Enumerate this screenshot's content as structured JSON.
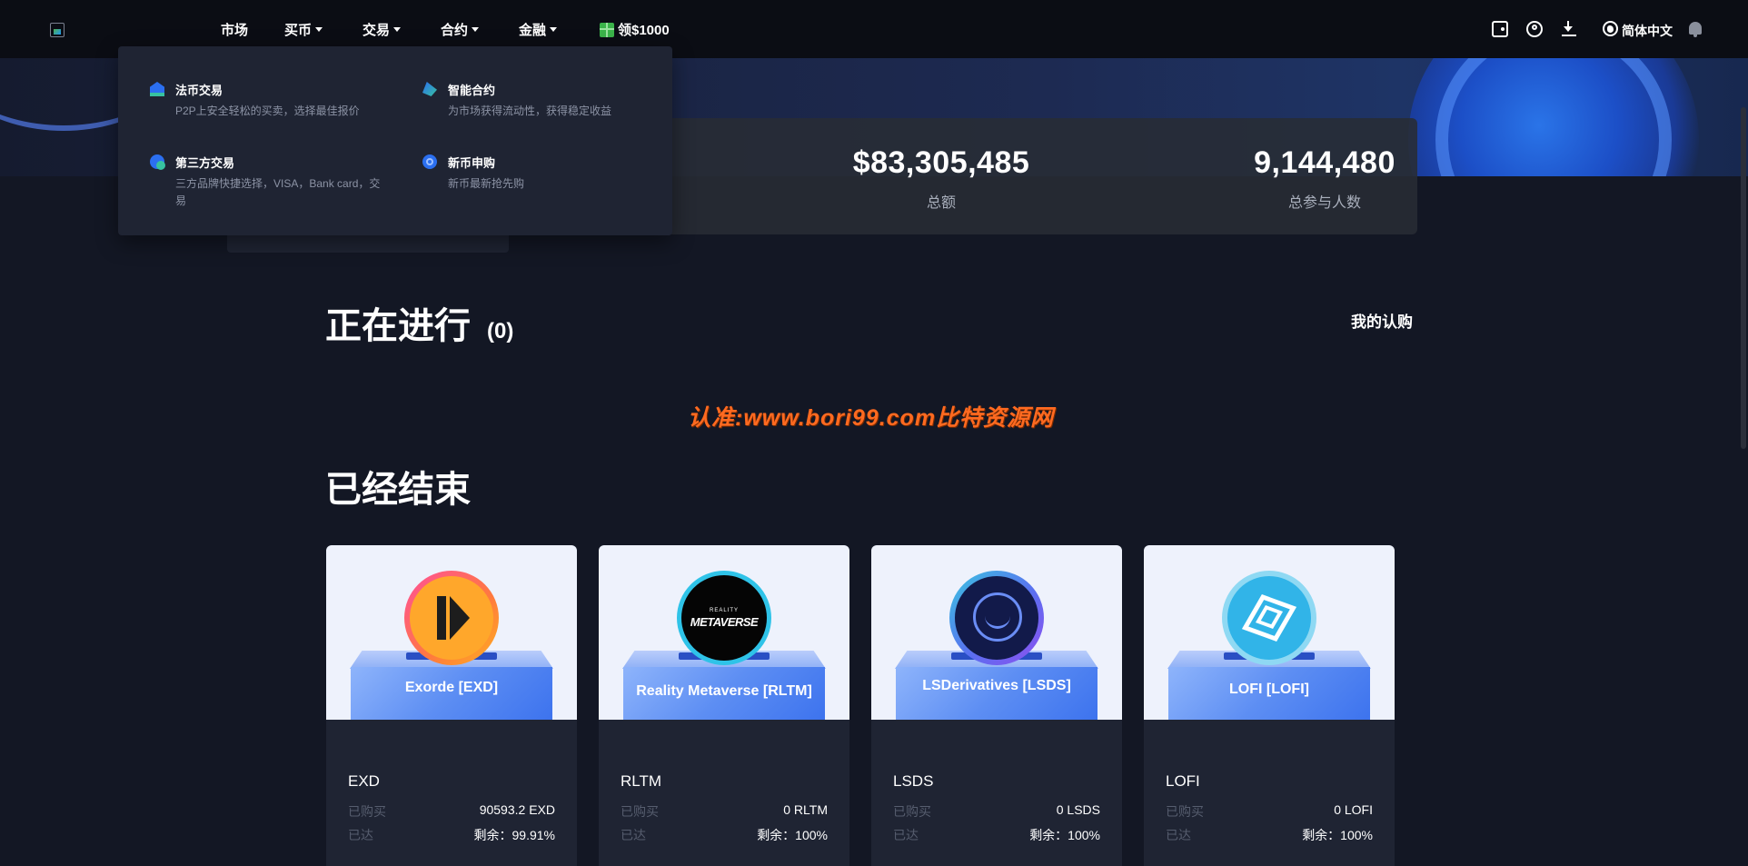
{
  "nav": {
    "items": [
      {
        "label": "市场",
        "has_caret": false
      },
      {
        "label": "买币",
        "has_caret": true
      },
      {
        "label": "交易",
        "has_caret": true
      },
      {
        "label": "合约",
        "has_caret": true
      },
      {
        "label": "金融",
        "has_caret": true
      }
    ],
    "bonus_label": "领$1000",
    "icons": [
      "wallet-icon",
      "user-icon",
      "download-icon",
      "globe-icon",
      "bell-icon"
    ],
    "language": "简体中文"
  },
  "dropdown": {
    "items": [
      {
        "icon": "fiat-icon",
        "title": "法币交易",
        "desc": "P2P上安全轻松的买卖，选择最佳报价"
      },
      {
        "icon": "smart-contract-icon",
        "title": "智能合约",
        "desc": "为市场获得流动性，获得稳定收益"
      },
      {
        "icon": "third-party-icon",
        "title": "第三方交易",
        "desc": "三方品牌快捷选择，VISA，Bank card，交易"
      },
      {
        "icon": "new-coin-icon",
        "title": "新币申购",
        "desc": "新币最新抢先购"
      }
    ]
  },
  "stats": [
    {
      "value": "$83,305,485",
      "label": "总额"
    },
    {
      "value": "9,144,480",
      "label": "总参与人数"
    }
  ],
  "ongoing": {
    "title": "正在进行",
    "count": "(0)",
    "my_subscription": "我的认购"
  },
  "watermark": "认准:www.bori99.com比特资源网",
  "ended": {
    "title": "已经结束",
    "cards": [
      {
        "box_label": "Exorde [EXD]",
        "symbol": "EXD",
        "bought_label": "已购买",
        "bought_value": "90593.2 EXD",
        "reached_label": "已达",
        "remaining": "剩余：99.91%"
      },
      {
        "box_label": "Reality Metaverse [RLTM]",
        "symbol": "RLTM",
        "bought_label": "已购买",
        "bought_value": "0 RLTM",
        "reached_label": "已达",
        "remaining": "剩余：100%",
        "coin_small": "REALITY",
        "coin_main": "METAVERSE"
      },
      {
        "box_label": "LSDerivatives [LSDS]",
        "symbol": "LSDS",
        "bought_label": "已购买",
        "bought_value": "0 LSDS",
        "reached_label": "已达",
        "remaining": "剩余：100%"
      },
      {
        "box_label": "LOFI [LOFI]",
        "symbol": "LOFI",
        "bought_label": "已购买",
        "bought_value": "0 LOFI",
        "reached_label": "已达",
        "remaining": "剩余：100%"
      }
    ]
  },
  "colors": {
    "accent_blue": "#2b6ff0",
    "watermark_orange": "#ff6a20",
    "bg": "#131724",
    "card_bg": "#1f2433"
  }
}
